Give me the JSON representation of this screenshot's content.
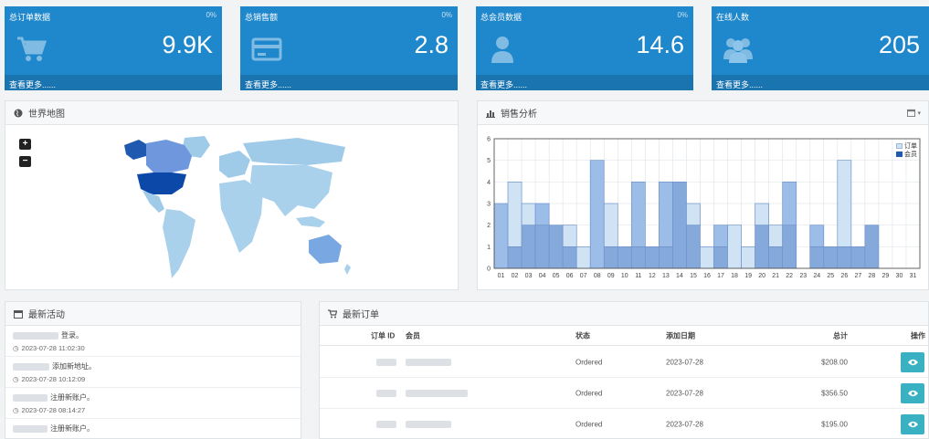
{
  "tiles": [
    {
      "title": "总订单数据",
      "pct": "0%",
      "value": "9.9K",
      "footer": "查看更多......",
      "icon": "shopping-cart-icon"
    },
    {
      "title": "总销售额",
      "pct": "0%",
      "value": "2.8",
      "footer": "查看更多......",
      "icon": "credit-card-icon"
    },
    {
      "title": "总会员数据",
      "pct": "0%",
      "value": "14.6",
      "footer": "查看更多......",
      "icon": "user-icon"
    },
    {
      "title": "在线人数",
      "pct": "",
      "value": "205",
      "footer": "查看更多......",
      "icon": "users-icon"
    }
  ],
  "map_panel": {
    "title": "世界地图",
    "zoom_in": "+",
    "zoom_out": "−"
  },
  "sales_panel": {
    "title": "销售分析"
  },
  "chart_data": {
    "type": "bar",
    "categories": [
      "01",
      "02",
      "03",
      "04",
      "05",
      "06",
      "07",
      "08",
      "09",
      "10",
      "11",
      "12",
      "13",
      "14",
      "15",
      "16",
      "17",
      "18",
      "19",
      "20",
      "21",
      "22",
      "23",
      "24",
      "25",
      "26",
      "27",
      "28",
      "29",
      "30",
      "31"
    ],
    "series": [
      {
        "name": "订单",
        "values": [
          0,
          4,
          3,
          2,
          2,
          2,
          1,
          0,
          3,
          1,
          1,
          1,
          1,
          4,
          3,
          1,
          1,
          2,
          1,
          3,
          2,
          2,
          0,
          1,
          1,
          5,
          1,
          2,
          0,
          0,
          0
        ]
      },
      {
        "name": "会员",
        "values": [
          3,
          1,
          2,
          3,
          2,
          1,
          0,
          5,
          1,
          1,
          4,
          1,
          4,
          4,
          2,
          0,
          2,
          0,
          0,
          2,
          1,
          4,
          0,
          2,
          1,
          1,
          1,
          2,
          0,
          0,
          0
        ]
      }
    ],
    "ylim": [
      0,
      6
    ],
    "yticks": [
      0,
      1,
      2,
      3,
      4,
      5,
      6
    ],
    "grid": true,
    "legend_position": "top-right",
    "colors": {
      "orders": "#cfe3f4",
      "members": "#9dbde9",
      "overlap": "#86a9dc",
      "edge": "#6f93c9"
    }
  },
  "activity_panel": {
    "title": "最新活动",
    "items": [
      {
        "action": "登录。",
        "time": "2023-07-28 11:02:30"
      },
      {
        "action": "添加新地址。",
        "time": "2023-07-28 10:12:09"
      },
      {
        "action": "注册新账户。",
        "time": "2023-07-28 08:14:27"
      },
      {
        "action": "注册新账户。",
        "time": ""
      }
    ]
  },
  "orders_panel": {
    "title": "最新订单",
    "columns": {
      "id": "订单 ID",
      "member": "会员",
      "status": "状态",
      "date": "添加日期",
      "total": "总计",
      "action": "操作"
    },
    "rows": [
      {
        "status": "Ordered",
        "date": "2023-07-28",
        "total": "$208.00"
      },
      {
        "status": "Ordered",
        "date": "2023-07-28",
        "total": "$356.50"
      },
      {
        "status": "Ordered",
        "date": "2023-07-28",
        "total": "$195.00"
      }
    ]
  }
}
